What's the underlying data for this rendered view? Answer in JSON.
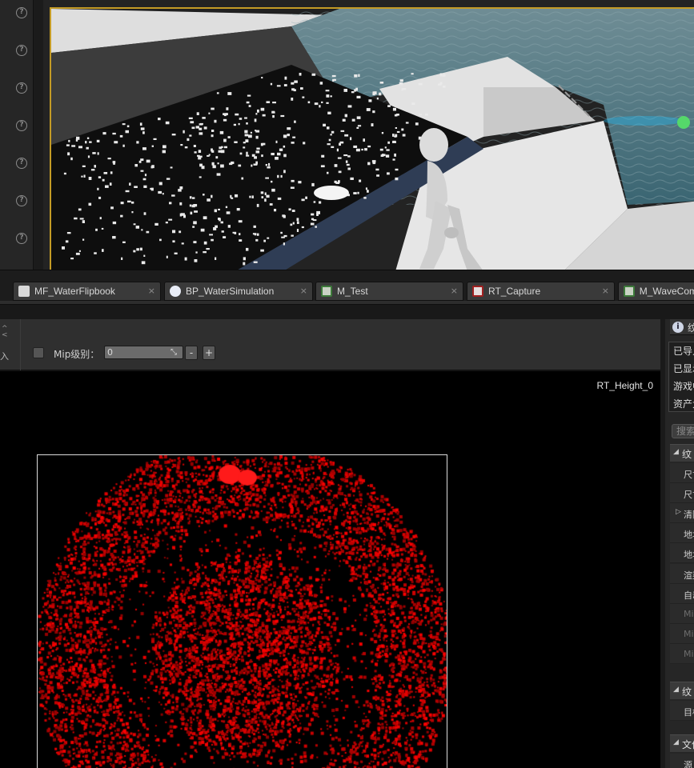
{
  "viewport": {
    "help_icon_glyph": "?",
    "help_icon_count": 7
  },
  "tabs": [
    {
      "label": "MF_WaterFlipbook",
      "icon": "material-function-icon",
      "close": "×"
    },
    {
      "label": "BP_WaterSimulation",
      "icon": "blueprint-icon",
      "close": "×"
    },
    {
      "label": "M_Test",
      "icon": "material-icon",
      "close": "×"
    },
    {
      "label": "RT_Capture",
      "icon": "render-target-icon",
      "close": "×"
    },
    {
      "label": "M_WaveCom",
      "icon": "material-icon",
      "close": ""
    }
  ],
  "toolbar": {
    "import_label": "入",
    "mip_label": "Mip级别：",
    "mip_value": "0",
    "minus_label": "-",
    "plus_label": "+"
  },
  "texture_viewer": {
    "texture_name": "RT_Height_0"
  },
  "details": {
    "header_icon_glyph": "i",
    "header_text": "纹",
    "info_lines": [
      "已导入",
      "已显示",
      "游戏中",
      "资产大"
    ],
    "search_placeholder": "搜索",
    "categories": [
      {
        "label": "纹",
        "properties": [
          {
            "label": "尺寸",
            "dim": false,
            "expander": ""
          },
          {
            "label": "尺寸",
            "dim": false,
            "expander": ""
          },
          {
            "label": "清除",
            "dim": false,
            "expander": "▷"
          },
          {
            "label": "地址",
            "dim": false,
            "expander": ""
          },
          {
            "label": "地址",
            "dim": false,
            "expander": ""
          },
          {
            "label": "渲染",
            "dim": false,
            "expander": ""
          },
          {
            "label": "自动",
            "dim": false,
            "expander": ""
          },
          {
            "label": "Mi",
            "dim": true,
            "expander": ""
          },
          {
            "label": "Mi",
            "dim": true,
            "expander": ""
          },
          {
            "label": "Mi",
            "dim": true,
            "expander": ""
          }
        ]
      },
      {
        "label": "纹",
        "properties": [
          {
            "label": "目标",
            "dim": false,
            "expander": ""
          }
        ]
      },
      {
        "label": "文件",
        "properties": [
          {
            "label": "源",
            "dim": false,
            "expander": ""
          }
        ]
      }
    ]
  },
  "colors": {
    "viewport_border": "#c49b25",
    "heightmap_red": "#e00000",
    "water": "#3f6d7c"
  }
}
